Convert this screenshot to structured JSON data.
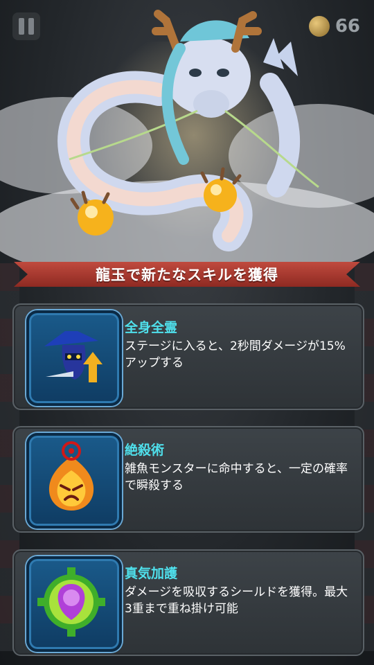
{
  "hud": {
    "coin_count": "66",
    "pause_icon": "pause-icon",
    "coin_icon": "leaf-coin-icon"
  },
  "banner": {
    "title": "龍玉で新たなスキルを獲得"
  },
  "skills": [
    {
      "name": "全身全霊",
      "description": "ステージに入ると、2秒間ダメージが15%アップする",
      "icon": "ninja-sword-powerup-icon"
    },
    {
      "name": "絶殺術",
      "description": "雑魚モンスターに命中すると、一定の確率で瞬殺する",
      "icon": "angry-flame-face-icon"
    },
    {
      "name": "真気加護",
      "description": "ダメージを吸収するシールドを獲得。最大3重まで重ね掛け可能",
      "icon": "purple-shield-gear-icon"
    }
  ],
  "colors": {
    "banner_red": "#b03a30",
    "skill_name_cyan": "#4fe0ec",
    "card_bg": "#363b40",
    "icon_frame_blue": "#1a5a8a"
  }
}
